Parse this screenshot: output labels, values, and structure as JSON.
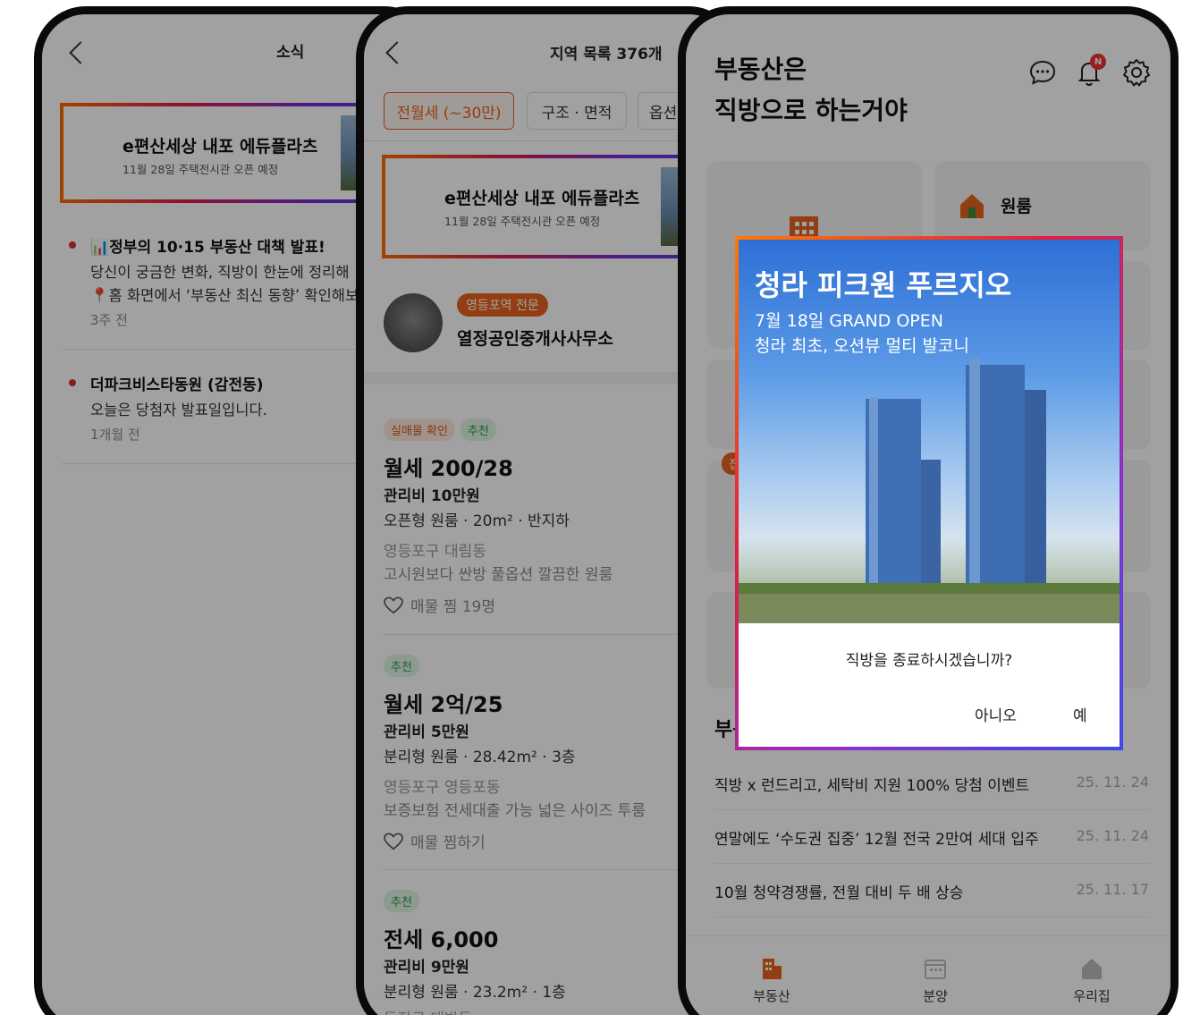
{
  "news_screen": {
    "title": "소식",
    "ad": {
      "title": "e편산세상 내포 에듀플라츠",
      "subtitle": "11월 28일 주택전시관 오픈 예정"
    },
    "items": [
      {
        "title": "📊정부의 10·15 부동산 대책 발표!",
        "body1": "당신이 궁금한 변화, 직방이 한눈에 정리해",
        "body2": "📍홈 화면에서 ‘부동산 최신 동향’ 확인해보",
        "time": "3주 전"
      },
      {
        "title": "더파크비스타동원 (감전동)",
        "body1": "오늘은 당첨자 발표일입니다.",
        "time": "1개월 전"
      }
    ]
  },
  "list_screen": {
    "title": "지역 목록 376개",
    "filters": [
      "전월세 (~30만)",
      "구조 · 면적",
      "옵션"
    ],
    "ad": {
      "title": "e편산세상 내포 에듀플라츠",
      "subtitle": "11월 28일 주택전시관 오픈 예정"
    },
    "agent": {
      "badge": "영등포역 전문",
      "name": "열정공인중개사사무소"
    },
    "listings": [
      {
        "tags": [
          "실매물 확인",
          "추천"
        ],
        "price": "월세 200/28",
        "fee": "관리비 10만원",
        "spec": "오픈형 원룸 · 20m² · 반지하",
        "location": "영등포구 대림동",
        "desc": "고시원보다 싼방 풀옵션 깔끔한 원룸",
        "fav": "매물 찜 19명"
      },
      {
        "tags": [
          "추천"
        ],
        "price": "월세 2억/25",
        "fee": "관리비 5만원",
        "spec": "분리형 원룸 · 28.42m² · 3층",
        "location": "영등포구 영등포동",
        "desc": "보증보험 전세대출 가능 넓은 사이즈 투룸",
        "fav": "매물 찜하기"
      },
      {
        "tags": [
          "추천"
        ],
        "price": "전세 6,000",
        "fee": "관리비 9만원",
        "spec": "분리형 원룸 · 23.2m² · 1층",
        "location": "동작구 대방동"
      }
    ]
  },
  "home_screen": {
    "heading_line1": "부동산은",
    "heading_line2": "직방으로 하는거야",
    "notif_badge": "N",
    "tile_oneroom": "원룸",
    "tile_badge_partial": "집",
    "notice_title_partial": "부동",
    "notices": [
      {
        "text": "직방 x 런드리고, 세탁비 지원 100% 당첨 이벤트",
        "date": "25. 11. 24"
      },
      {
        "text": "연말에도 ‘수도권 집중’ 12월 전국 2만여 세대 입주",
        "date": "25. 11. 24"
      },
      {
        "text": "10월 청약경쟁률, 전월 대비 두 배 상승",
        "date": "25. 11. 17"
      }
    ],
    "tabs": [
      "부동산",
      "분양",
      "우리집"
    ]
  },
  "modal": {
    "headline": "청라 피크원 푸르지오",
    "sub1": "7월 18일 GRAND OPEN",
    "sub2": "청라 최초, 오션뷰 멀티 발코니",
    "question": "직방을 종료하시겠습니까?",
    "no_label": "아니오",
    "yes_label": "예"
  },
  "colors": {
    "accent": "#e8621d",
    "badge_red": "#e33333",
    "recommend_green": "#2e9a4c"
  }
}
